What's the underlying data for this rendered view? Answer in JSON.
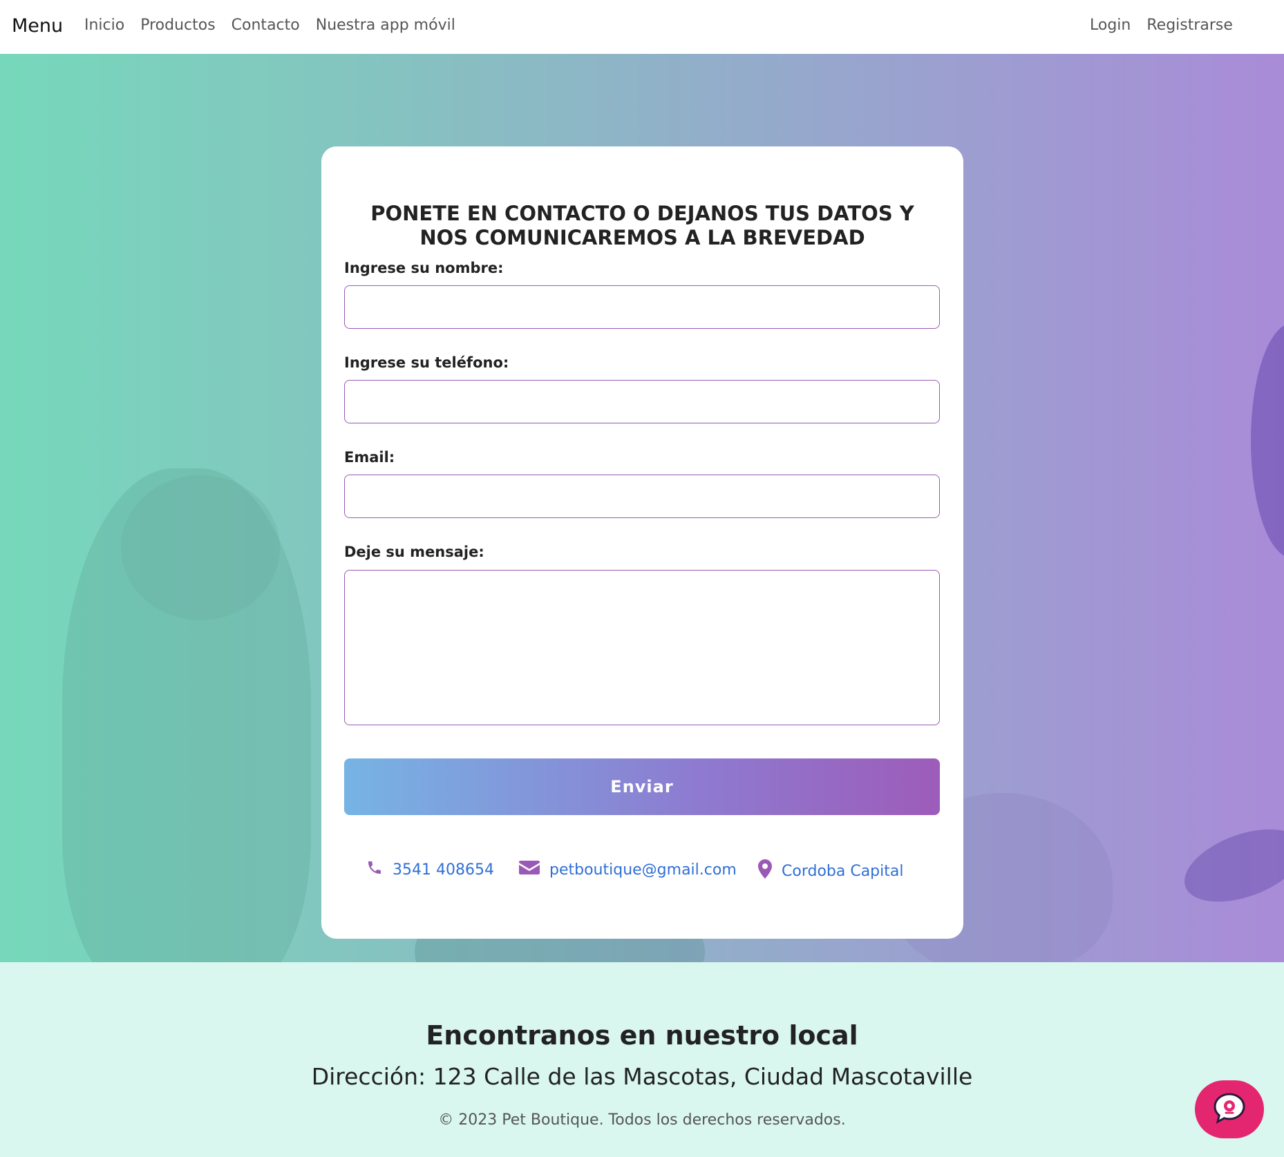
{
  "nav": {
    "brand": "Menu",
    "links": [
      "Inicio",
      "Productos",
      "Contacto",
      "Nuestra app móvil"
    ],
    "right_links": [
      "Login",
      "Registrarse"
    ]
  },
  "form": {
    "title": "PONETE EN CONTACTO O DEJANOS TUS DATOS Y NOS COMUNICAREMOS A LA BREVEDAD",
    "name_label": "Ingrese su nombre:",
    "phone_label": "Ingrese su teléfono:",
    "email_label": "Email:",
    "message_label": "Deje su mensaje:",
    "submit_label": "Enviar"
  },
  "contact": {
    "phone": "3541 408654",
    "email": "petboutique@gmail.com",
    "location": "Cordoba Capital"
  },
  "footer": {
    "heading": "Encontranos en nuestro local",
    "address": "Dirección: 123 Calle de las Mascotas, Ciudad Mascotaville",
    "copyright": "© 2023 Pet Boutique. Todos los derechos reservados."
  },
  "colors": {
    "accent": "#9b59b6",
    "link": "#2f6fd6",
    "chat_button": "#e3266f",
    "footer_bg": "#d9f7ef"
  },
  "icons": [
    "phone-icon",
    "envelope-icon",
    "map-pin-icon",
    "chat-icon"
  ]
}
